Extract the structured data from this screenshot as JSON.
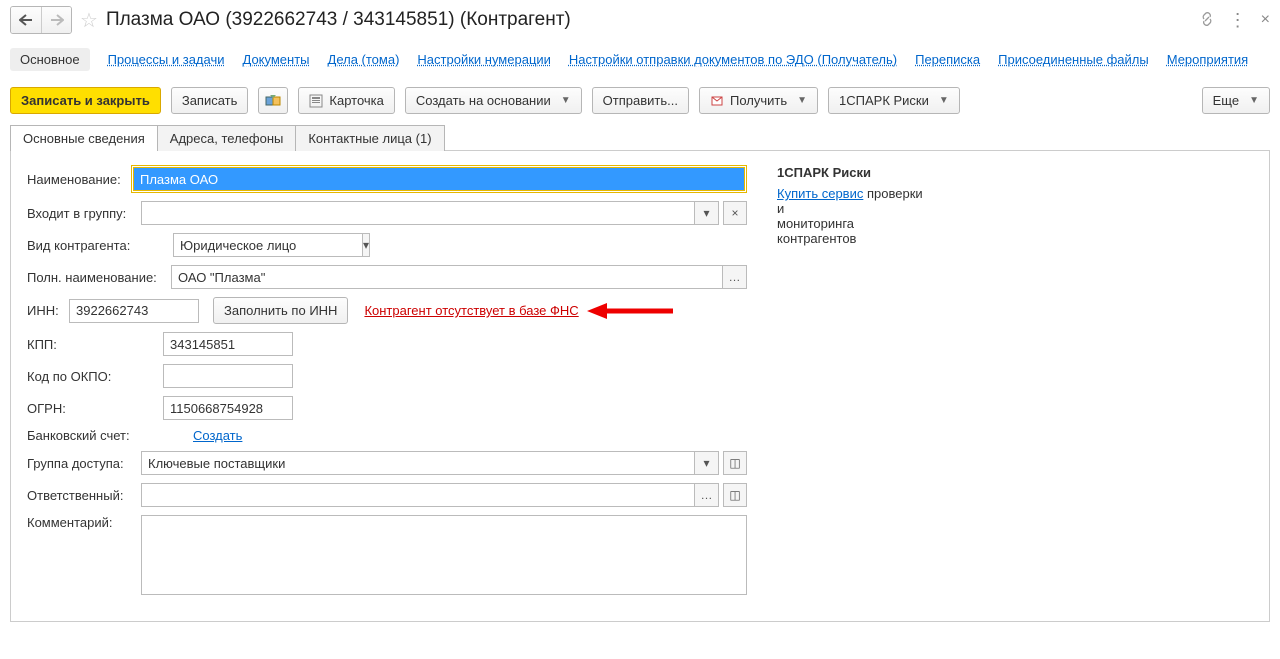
{
  "header": {
    "title": "Плазма ОАО (3922662743 / 343145851) (Контрагент)"
  },
  "navLinks": {
    "main": "Основное",
    "processes": "Процессы и задачи",
    "documents": "Документы",
    "cases": "Дела (тома)",
    "numbering": "Настройки нумерации",
    "edo": "Настройки отправки документов по ЭДО (Получатель)",
    "correspondence": "Переписка",
    "files": "Присоединенные файлы",
    "events": "Мероприятия"
  },
  "toolbar": {
    "saveClose": "Записать и закрыть",
    "save": "Записать",
    "card": "Карточка",
    "createBasedOn": "Создать на основании",
    "send": "Отправить...",
    "receive": "Получить",
    "sparkRisks": "1СПАРК Риски",
    "more": "Еще"
  },
  "tabs": {
    "basic": "Основные сведения",
    "addresses": "Адреса, телефоны",
    "contacts": "Контактные лица (1)"
  },
  "form": {
    "labels": {
      "name": "Наименование:",
      "group": "Входит в группу:",
      "type": "Вид контрагента:",
      "fullName": "Полн. наименование:",
      "inn": "ИНН:",
      "fillByInn": "Заполнить по ИНН",
      "fnsWarning": "Контрагент отсутствует в базе ФНС",
      "kpp": "КПП:",
      "okpo": "Код по ОКПО:",
      "ogrn": "ОГРН:",
      "bank": "Банковский счет:",
      "createLink": "Создать",
      "accessGroup": "Группа доступа:",
      "responsible": "Ответственный:",
      "comment": "Комментарий:"
    },
    "values": {
      "name": "Плазма ОАО",
      "group": "",
      "type": "Юридическое лицо",
      "fullName": "ОАО \"Плазма\"",
      "inn": "3922662743",
      "kpp": "343145851",
      "okpo": "",
      "ogrn": "1150668754928",
      "accessGroup": "Ключевые поставщики",
      "responsible": "",
      "comment": ""
    }
  },
  "sidePanel": {
    "title": "1СПАРК Риски",
    "buyLink": "Купить сервис",
    "text1": "проверки",
    "text2": "и",
    "text3": "мониторинга",
    "text4": "контрагентов"
  }
}
